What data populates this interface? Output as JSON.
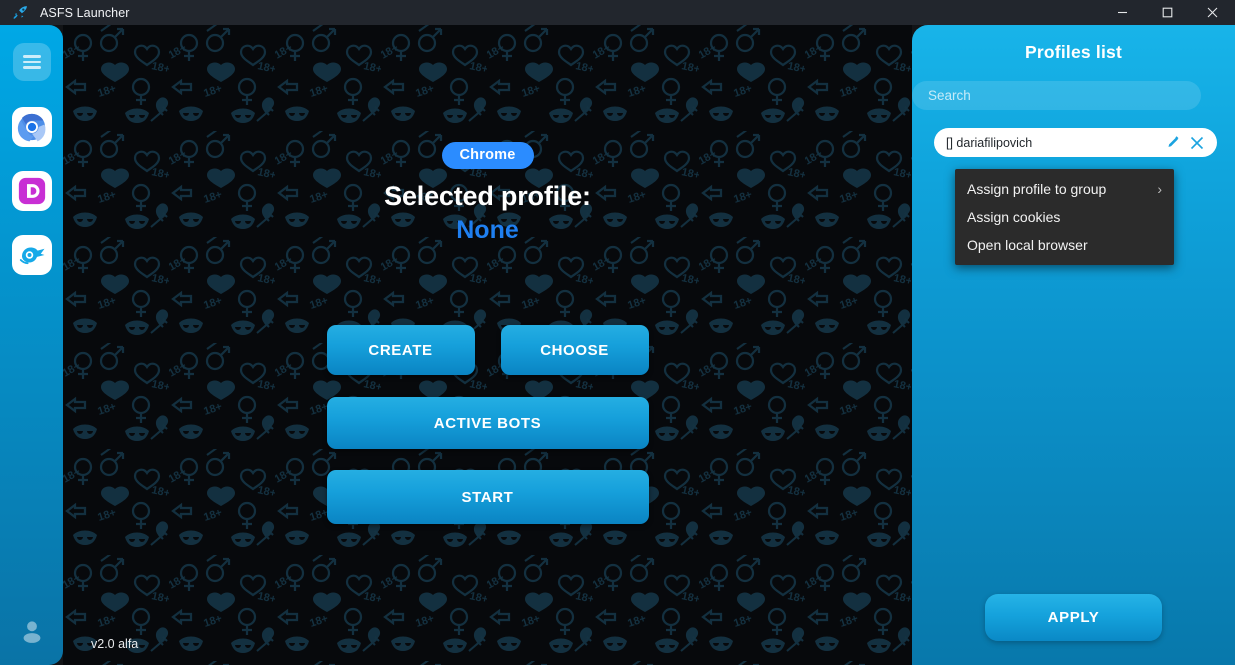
{
  "window": {
    "title": "ASFS Launcher",
    "logo_icon": "asfs-logo-icon",
    "controls": {
      "minimize": "—",
      "maximize": "□",
      "close": "✕"
    }
  },
  "sidebar": {
    "menu_icon": "hamburger-menu-icon",
    "apps": [
      {
        "name": "chrome-app-icon",
        "label": "Chrome"
      },
      {
        "name": "dolphin-anty-app-icon",
        "label": "Dolphin Anty"
      },
      {
        "name": "octo-browser-app-icon",
        "label": "Octo Browser"
      }
    ],
    "avatar_icon": "account-avatar-icon"
  },
  "main": {
    "browser_badge": "Chrome",
    "selected_label": "Selected profile:",
    "selected_value": "None",
    "buttons": {
      "create": "CREATE",
      "choose": "CHOOSE",
      "active_bots": "ACTIVE BOTS",
      "start": "START"
    },
    "version": "v2.0 alfa"
  },
  "right_panel": {
    "title": "Profiles list",
    "search": {
      "placeholder": "Search",
      "value": ""
    },
    "profiles": [
      {
        "name": "[] dariafilipovich",
        "edit_icon": "edit-pencil-icon",
        "delete_icon": "delete-close-icon"
      }
    ],
    "apply_label": "APPLY"
  },
  "context_menu": {
    "items": [
      {
        "label": "Assign profile to group",
        "has_submenu": true,
        "arrow": "›"
      },
      {
        "label": "Assign cookies",
        "has_submenu": false,
        "arrow": ""
      },
      {
        "label": "Open local browser",
        "has_submenu": false,
        "arrow": ""
      }
    ]
  },
  "colors": {
    "accent": "#16a0db",
    "badge": "#2b8cff",
    "selected_value": "#1f7ff0",
    "panel_top": "#18b4e9",
    "panel_bottom": "#0878ab",
    "menu_bg": "#2b2b2b",
    "titlebar": "#22262d"
  }
}
